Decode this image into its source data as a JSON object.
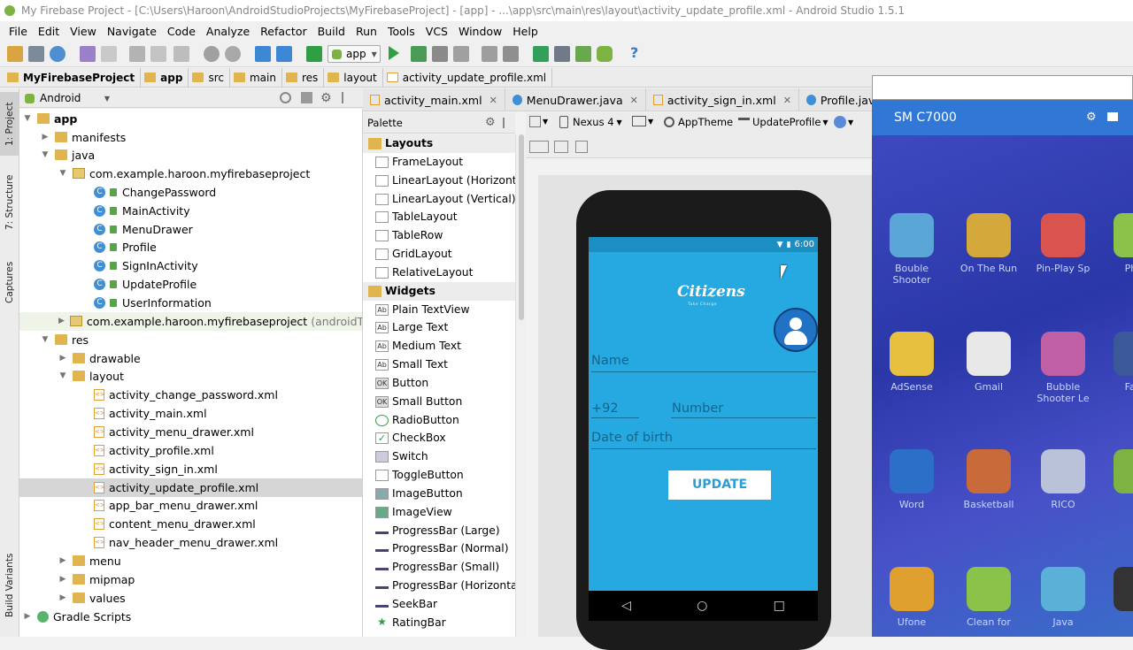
{
  "window": {
    "title": "My Firebase Project - [C:\\Users\\Haroon\\AndroidStudioProjects\\MyFirebaseProject] - [app] - ...\\app\\src\\main\\res\\layout\\activity_update_profile.xml - Android Studio 1.5.1"
  },
  "menu": [
    "File",
    "Edit",
    "View",
    "Navigate",
    "Code",
    "Analyze",
    "Refactor",
    "Build",
    "Run",
    "Tools",
    "VCS",
    "Window",
    "Help"
  ],
  "toolbar": {
    "run_config": "app",
    "help": "?"
  },
  "breadcrumb": [
    "MyFirebaseProject",
    "app",
    "src",
    "main",
    "res",
    "layout",
    "activity_update_profile.xml"
  ],
  "left_tabs": [
    "1: Project",
    "7: Structure",
    "Captures",
    "Build Variants"
  ],
  "project": {
    "view_mode": "Android",
    "tree": [
      {
        "label": "app",
        "bold": true
      },
      {
        "label": "manifests"
      },
      {
        "label": "java"
      },
      {
        "label": "com.example.haroon.myfirebaseproject"
      },
      {
        "label": "ChangePassword"
      },
      {
        "label": "MainActivity"
      },
      {
        "label": "MenuDrawer"
      },
      {
        "label": "Profile"
      },
      {
        "label": "SignInActivity"
      },
      {
        "label": "UpdateProfile"
      },
      {
        "label": "UserInformation"
      },
      {
        "label": "com.example.haroon.myfirebaseproject",
        "suffix": "(androidTest)"
      },
      {
        "label": "res"
      },
      {
        "label": "drawable"
      },
      {
        "label": "layout"
      },
      {
        "label": "activity_change_password.xml"
      },
      {
        "label": "activity_main.xml"
      },
      {
        "label": "activity_menu_drawer.xml"
      },
      {
        "label": "activity_profile.xml"
      },
      {
        "label": "activity_sign_in.xml"
      },
      {
        "label": "activity_update_profile.xml"
      },
      {
        "label": "app_bar_menu_drawer.xml"
      },
      {
        "label": "content_menu_drawer.xml"
      },
      {
        "label": "nav_header_menu_drawer.xml"
      },
      {
        "label": "menu"
      },
      {
        "label": "mipmap"
      },
      {
        "label": "values"
      },
      {
        "label": "Gradle Scripts"
      }
    ]
  },
  "editor_tabs": [
    "activity_main.xml",
    "MenuDrawer.java",
    "activity_sign_in.xml",
    "Profile.java"
  ],
  "palette": {
    "title": "Palette",
    "items": [
      {
        "label": "Layouts",
        "cat": true
      },
      {
        "label": "FrameLayout"
      },
      {
        "label": "LinearLayout (Horizontal)"
      },
      {
        "label": "LinearLayout (Vertical)"
      },
      {
        "label": "TableLayout"
      },
      {
        "label": "TableRow"
      },
      {
        "label": "GridLayout"
      },
      {
        "label": "RelativeLayout"
      },
      {
        "label": "Widgets",
        "cat": true
      },
      {
        "label": "Plain TextView",
        "icon": "Ab"
      },
      {
        "label": "Large Text",
        "icon": "Ab"
      },
      {
        "label": "Medium Text",
        "icon": "Ab"
      },
      {
        "label": "Small Text",
        "icon": "Ab"
      },
      {
        "label": "Button",
        "icon": "OK"
      },
      {
        "label": "Small Button",
        "icon": "OK"
      },
      {
        "label": "RadioButton"
      },
      {
        "label": "CheckBox"
      },
      {
        "label": "Switch"
      },
      {
        "label": "ToggleButton"
      },
      {
        "label": "ImageButton"
      },
      {
        "label": "ImageView"
      },
      {
        "label": "ProgressBar (Large)"
      },
      {
        "label": "ProgressBar (Normal)"
      },
      {
        "label": "ProgressBar (Small)"
      },
      {
        "label": "ProgressBar (Horizontal)"
      },
      {
        "label": "SeekBar"
      },
      {
        "label": "RatingBar"
      }
    ]
  },
  "designer": {
    "device": "Nexus 4",
    "theme": "AppTheme",
    "activity": "UpdateProfile"
  },
  "preview": {
    "time": "6:00",
    "logo": "Citizens",
    "logo_sub": "Take Charge",
    "name_hint": "Name",
    "country_code": "+92",
    "number_hint": "Number",
    "dob_hint": "Date of birth",
    "update_label": "UPDATE",
    "nav": [
      "◁",
      "○",
      "□"
    ]
  },
  "device_window": {
    "title": "SM C7000",
    "apps": [
      "Bouble Shooter",
      "On The Run",
      "Pin-Play Sp",
      "Phot",
      "AdSense",
      "Gmail",
      "Bubble Shooter Le",
      "Face",
      "Word",
      "Basketball",
      "RICO",
      "",
      "Ufone",
      "Clean for",
      "Java",
      ""
    ]
  },
  "colors": {
    "accent": "#26a9e1",
    "device_header": "#3077d6",
    "device_bg": "#2b3c9c"
  }
}
